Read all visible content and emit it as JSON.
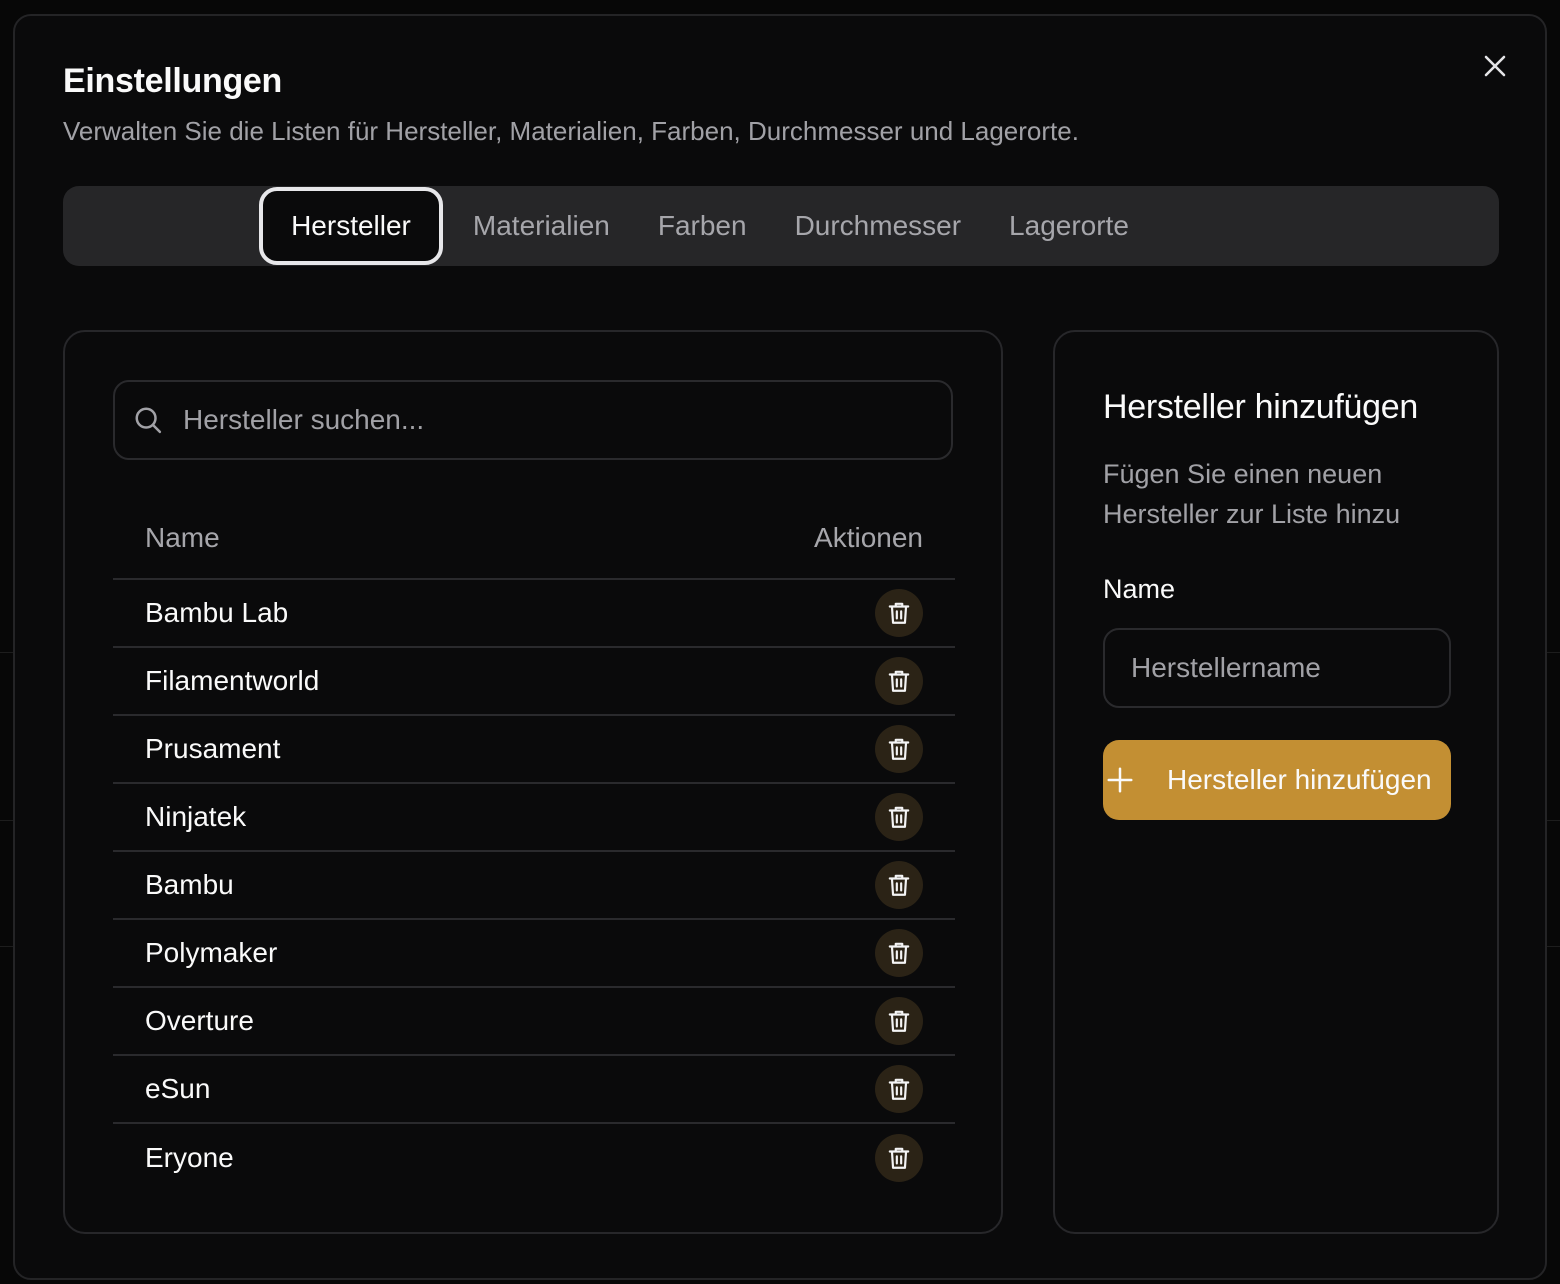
{
  "dialog": {
    "title": "Einstellungen",
    "subtitle": "Verwalten Sie die Listen für Hersteller, Materialien, Farben, Durchmesser und Lagerorte.",
    "close_icon": "close-icon"
  },
  "tabs": [
    {
      "label": "Hersteller",
      "active": true
    },
    {
      "label": "Materialien",
      "active": false
    },
    {
      "label": "Farben",
      "active": false
    },
    {
      "label": "Durchmesser",
      "active": false
    },
    {
      "label": "Lagerorte",
      "active": false
    }
  ],
  "list": {
    "search_placeholder": "Hersteller suchen...",
    "search_icon": "search-icon",
    "columns": {
      "name": "Name",
      "actions": "Aktionen"
    },
    "rows": [
      {
        "name": "Bambu Lab"
      },
      {
        "name": "Filamentworld"
      },
      {
        "name": "Prusament"
      },
      {
        "name": "Ninjatek"
      },
      {
        "name": "Bambu"
      },
      {
        "name": "Polymaker"
      },
      {
        "name": "Overture"
      },
      {
        "name": "eSun"
      },
      {
        "name": "Eryone"
      }
    ],
    "delete_icon": "trash-icon"
  },
  "add_form": {
    "title": "Hersteller hinzufügen",
    "description": "Fügen Sie einen neuen Hersteller zur Liste hinzu",
    "name_label": "Name",
    "name_placeholder": "Herstellername",
    "submit_label": "Hersteller hinzufügen",
    "submit_icon": "plus-icon"
  },
  "colors": {
    "accent": "#c38f33",
    "delete_bg": "#2b2316",
    "tab_bar_bg": "#262628",
    "modal_bg": "#0a0a0b"
  }
}
